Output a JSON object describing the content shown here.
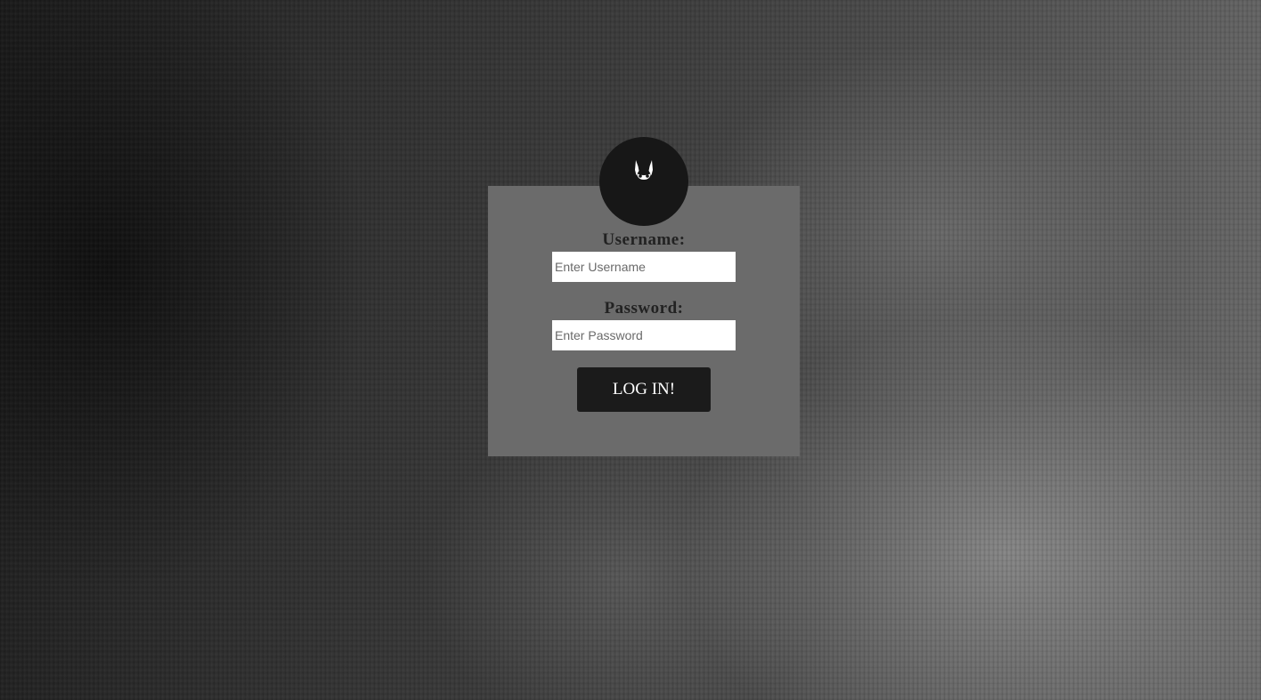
{
  "login": {
    "avatar_icon": "bat-ears-icon",
    "username_label": "Username:",
    "username_placeholder": "Enter Username",
    "username_value": "",
    "password_label": "Password:",
    "password_placeholder": "Enter Password",
    "password_value": "",
    "submit_label": "LOG IN!"
  },
  "colors": {
    "card_background": "#6b6b6b",
    "avatar_background": "#171717",
    "button_background": "#1b1b1b",
    "button_text": "#ffffff",
    "label_text": "#222222"
  }
}
